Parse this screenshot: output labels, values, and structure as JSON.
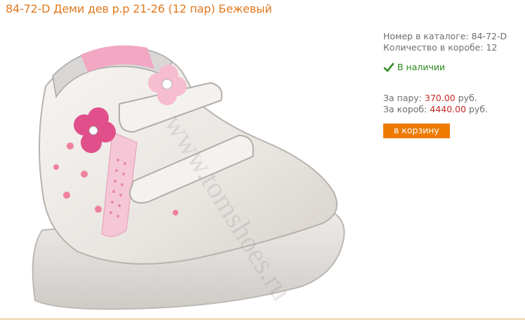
{
  "product": {
    "title": "84-72-D Деми дев р.р 21-26 (12 пар) Бежевый",
    "image_alt": "Детские ботинки белые с розовыми цветами",
    "watermark": "www.tomshoes.ru"
  },
  "info": {
    "catalog_number_label": "Номер в каталоге:",
    "catalog_number_value": "84-72-D",
    "box_quantity_label": "Количество в коробе:",
    "box_quantity_value": "12",
    "stock_status": "В наличии"
  },
  "prices": {
    "pair_label": "За пару:",
    "pair_value": "370.00",
    "pair_currency": "руб.",
    "box_label": "За короб:",
    "box_value": "4440.00",
    "box_currency": "руб."
  },
  "actions": {
    "add_to_cart_label": "в корзину"
  },
  "colors": {
    "title": "#e07a1f",
    "price": "#c62828",
    "button": "#ee7a00",
    "stock": "#2b8a1e"
  }
}
